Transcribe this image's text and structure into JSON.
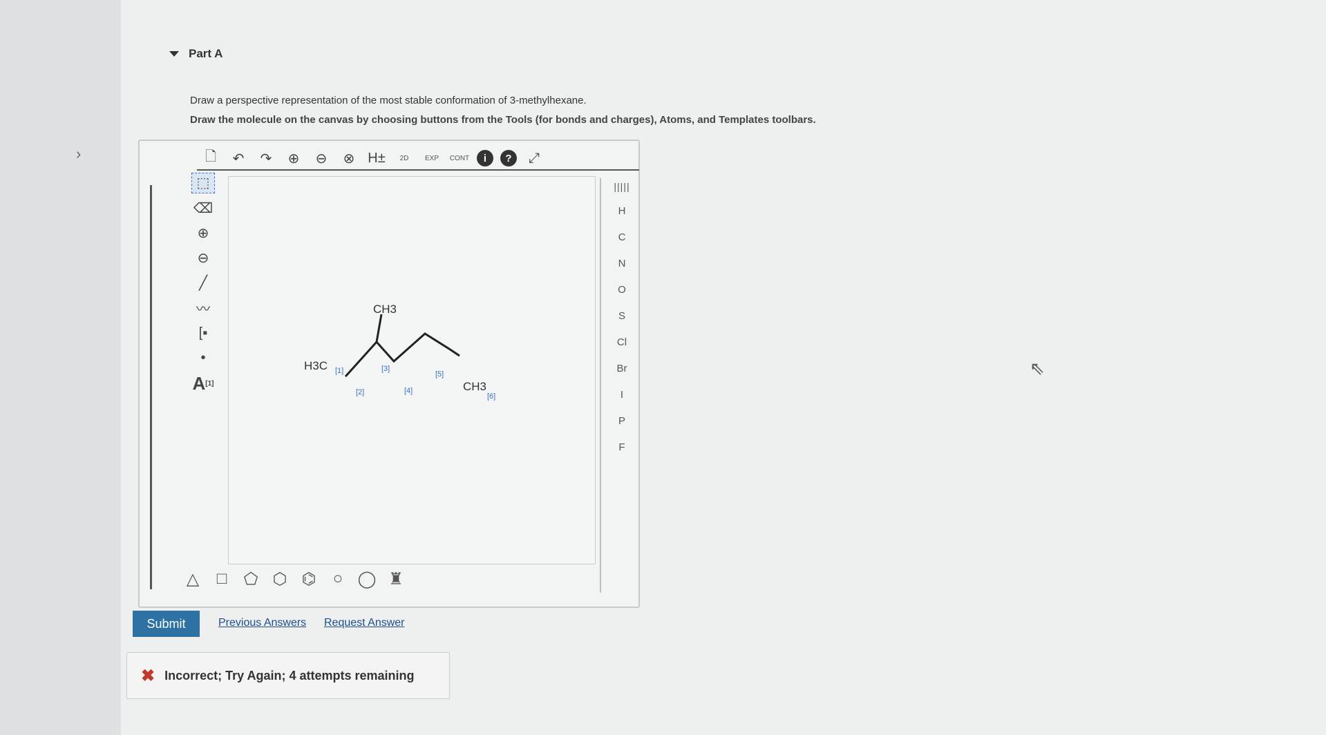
{
  "part": {
    "title": "Part A"
  },
  "instructions": {
    "line1": "Draw a perspective representation of the most stable conformation of 3-methylhexane.",
    "line2": "Draw the molecule on the canvas by choosing buttons from the Tools (for bonds and charges), Atoms, and Templates toolbars."
  },
  "toolbar_top": {
    "buttons": [
      "new-doc",
      "undo",
      "redo",
      "zoom-in",
      "zoom-out",
      "zoom-reset",
      "H±",
      "2D",
      "EXP",
      "CONT",
      "info",
      "help",
      "expand"
    ],
    "h_label": "H±",
    "twod_label": "2D",
    "exp_label": "EXP",
    "cont_label": "CONT"
  },
  "toolbar_left": {
    "a_label": "A",
    "a_sup": "[1]"
  },
  "atoms": {
    "periodic_label": "|||||",
    "list": [
      "H",
      "C",
      "N",
      "O",
      "S",
      "Cl",
      "Br",
      "I",
      "P",
      "F"
    ]
  },
  "molecule": {
    "labels": {
      "h3c": "H3C",
      "ch3_top": "CH3",
      "ch3_right": "CH3"
    },
    "map_numbers": [
      "[1]",
      "[2]",
      "[3]",
      "[4]",
      "[5]",
      "[6]"
    ]
  },
  "actions": {
    "submit": "Submit",
    "previous": "Previous Answers",
    "request": "Request Answer"
  },
  "feedback": {
    "text": "Incorrect; Try Again; 4 attempts remaining"
  }
}
